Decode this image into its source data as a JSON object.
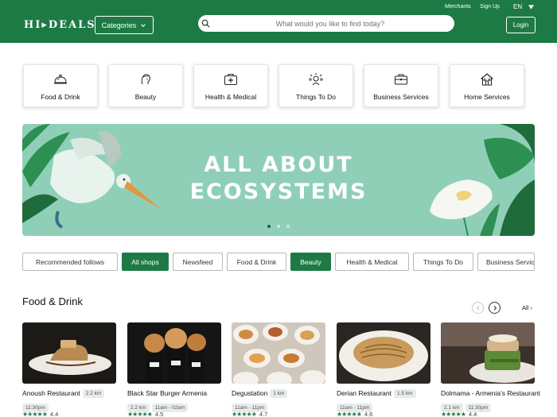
{
  "header": {
    "logo": "HI▸DEALS",
    "categories_label": "Categories",
    "search_placeholder": "What would you like to find today?",
    "merchants": "Merchants",
    "signup": "Sign Up",
    "language": "EN",
    "login": "Login"
  },
  "categories": [
    {
      "label": "Food & Drink",
      "icon": "cloche-icon"
    },
    {
      "label": "Beauty",
      "icon": "face-icon"
    },
    {
      "label": "Health & Medical",
      "icon": "medkit-icon"
    },
    {
      "label": "Things To Do",
      "icon": "activities-icon"
    },
    {
      "label": "Business Services",
      "icon": "briefcase-icon"
    },
    {
      "label": "Home Services",
      "icon": "house-icon"
    }
  ],
  "banner": {
    "line1": "ALL ABOUT",
    "line2": "ECOSYSTEMS",
    "slides": 3,
    "active_slide": 1
  },
  "tabs": [
    {
      "label": "Recommended follows",
      "active": false
    },
    {
      "label": "All shops",
      "active": true
    },
    {
      "label": "Newsfeed",
      "active": false
    },
    {
      "label": "Food & Drink",
      "active": false
    },
    {
      "label": "Beauty",
      "active": true
    },
    {
      "label": "Health & Medical",
      "active": false
    },
    {
      "label": "Things To Do",
      "active": false
    },
    {
      "label": "Business Servic",
      "active": false
    }
  ],
  "section": {
    "title": "Food & Drink",
    "all_label": "All ›"
  },
  "shops": [
    {
      "name": "Anoush Restaurant",
      "distance": "2.2 km",
      "hours": "11:30pm",
      "stars": "★★★★★",
      "rating": "4.4"
    },
    {
      "name": "Black Star Burger Armenia",
      "distance": "2.2 km",
      "hours": "11am - 02am",
      "stars": "★★★★★",
      "rating": "4.5"
    },
    {
      "name": "Degustation",
      "distance": "1 km",
      "hours": "11am - 11pm",
      "stars": "★★★★★",
      "rating": "4.7"
    },
    {
      "name": "Derian Restaurant",
      "distance": "1.5 km",
      "hours": "11am - 11pm",
      "stars": "★★★★★",
      "rating": "4.6"
    },
    {
      "name": "Dolmama - Armenia's Restaurant",
      "distance": "2.1 km",
      "hours": "11:30pm",
      "stars": "★★★★★",
      "rating": "4.4"
    }
  ],
  "colors": {
    "brand_green": "#1e7a45",
    "banner_bg": "#8fcfb8"
  }
}
